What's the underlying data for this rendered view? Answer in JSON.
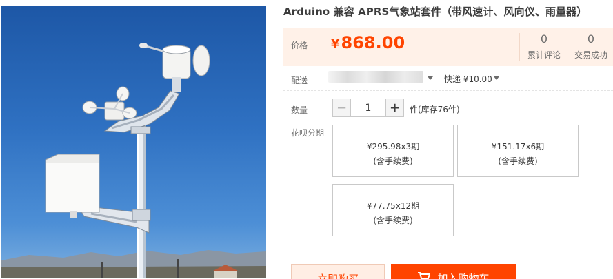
{
  "product": {
    "title": "Arduino 兼容 APRS气象站套件（带风速计、风向仪、雨量器）",
    "image_icon": "weather-station-photo"
  },
  "price": {
    "label": "价格",
    "currency": "¥",
    "value": "868.00"
  },
  "stats": {
    "reviews_count": "0",
    "reviews_label": "累计评论",
    "sales_count": "0",
    "sales_label": "交易成功"
  },
  "delivery": {
    "label": "配送",
    "shipping": "快递 ¥10.00"
  },
  "quantity": {
    "label": "数量",
    "value": "1",
    "minus": "−",
    "plus": "+",
    "stock": "件(库存76件)"
  },
  "installment": {
    "label": "花呗分期",
    "plans": [
      {
        "amount": "¥295.98x3期",
        "fee": "(含手续费)"
      },
      {
        "amount": "¥151.17x6期",
        "fee": "(含手续费)"
      },
      {
        "amount": "¥77.75x12期",
        "fee": "(含手续费)"
      }
    ]
  },
  "actions": {
    "buy_now": "立即购买",
    "add_to_cart": "加入购物车"
  },
  "colors": {
    "accent": "#ff4400",
    "price_bg": "#fff1e8"
  }
}
